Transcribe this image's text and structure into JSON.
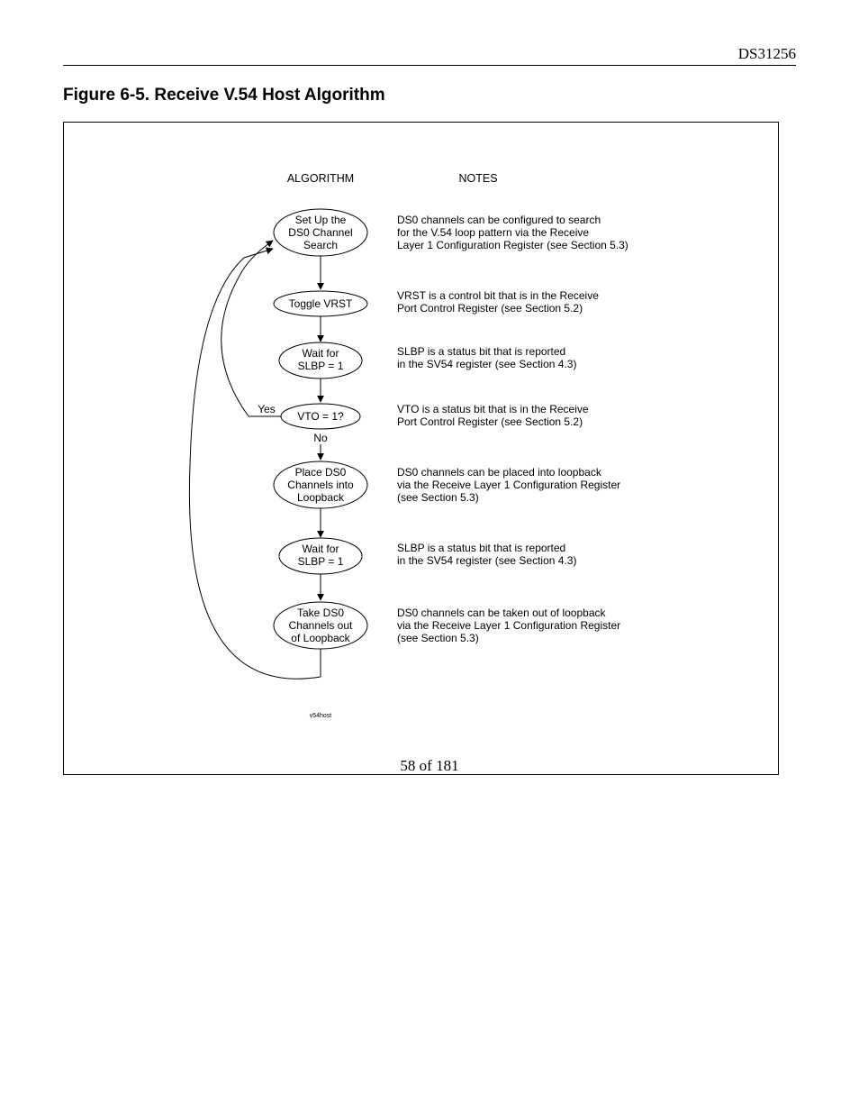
{
  "header": {
    "doc_id": "DS31256"
  },
  "figure": {
    "title": "Figure 6-5. Receive V.54 Host Algorithm"
  },
  "columns": {
    "algo": "ALGORITHM",
    "notes": "NOTES"
  },
  "nodes": {
    "n1l1": "Set Up the",
    "n1l2": "DS0 Channel",
    "n1l3": "Search",
    "n2": "Toggle VRST",
    "n3l1": "Wait for",
    "n3l2": "SLBP = 1",
    "n4": "VTO = 1?",
    "n5l1": "Place DS0",
    "n5l2": "Channels into",
    "n5l3": "Loopback",
    "n6l1": "Wait for",
    "n6l2": "SLBP = 1",
    "n7l1": "Take DS0",
    "n7l2": "Channels out",
    "n7l3": "of Loopback"
  },
  "branches": {
    "yes": "Yes",
    "no": "No"
  },
  "notes": {
    "r1l1": "DS0 channels can be configured to search",
    "r1l2": "for the V.54 loop pattern via the Receive",
    "r1l3": "Layer 1 Configuration Register (see Section 5.3)",
    "r2l1": "VRST is a control bit that is in the Receive",
    "r2l2": "Port Control Register (see Section 5.2)",
    "r3l1": "SLBP is a status bit that is reported",
    "r3l2": "in the SV54 register (see Section 4.3)",
    "r4l1": "VTO is a status bit that is in the Receive",
    "r4l2": "Port Control Register (see Section 5.2)",
    "r5l1": "DS0 channels can be placed into loopback",
    "r5l2": "via the Receive Layer 1 Configuration Register",
    "r5l3": "(see Section 5.3)",
    "r6l1": "SLBP is a status bit that is reported",
    "r6l2": "in the SV54 register (see Section 4.3)",
    "r7l1": "DS0 channels can be taken out of loopback",
    "r7l2": "via the Receive Layer 1 Configuration Register",
    "r7l3": "(see Section 5.3)"
  },
  "caption_tiny": "v54host",
  "footer": {
    "page": "58 of 181"
  }
}
